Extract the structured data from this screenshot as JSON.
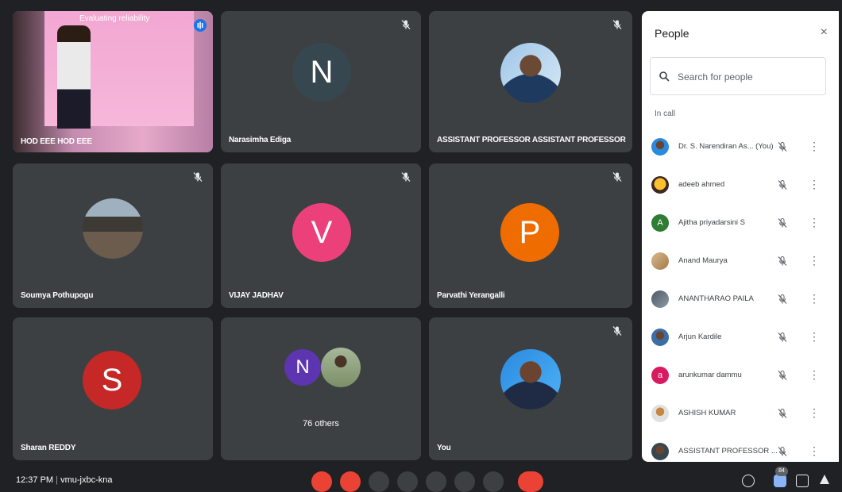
{
  "tiles": [
    {
      "name": "HOD EEE HOD EEE",
      "slide_title": "Evaluating reliability"
    },
    {
      "name": "Narasimha Ediga",
      "initial": "N"
    },
    {
      "name": "ASSISTANT PROFESSOR ASSISTANT PROFESSOR"
    },
    {
      "name": "Soumya Pothupogu"
    },
    {
      "name": "VIJAY JADHAV",
      "initial": "V"
    },
    {
      "name": "Parvathi Yerangalli",
      "initial": "P"
    },
    {
      "name": "Sharan REDDY",
      "initial": "S"
    },
    {
      "name": "76 others",
      "initial": "N"
    },
    {
      "name": "You"
    }
  ],
  "people": {
    "title": "People",
    "close": "×",
    "search_placeholder": "Search for people",
    "section": "In call",
    "list": [
      {
        "name": "Dr. S. Narendiran As...  (You)"
      },
      {
        "name": "adeeb ahmed"
      },
      {
        "name": "Ajitha priyadarsini S",
        "initial": "A"
      },
      {
        "name": "Anand Maurya"
      },
      {
        "name": "ANANTHARAO PAILA"
      },
      {
        "name": "Arjun Kardile"
      },
      {
        "name": "arunkumar dammu",
        "initial": "a"
      },
      {
        "name": "ASHISH KUMAR"
      },
      {
        "name": "ASSISTANT PROFESSOR ..."
      }
    ]
  },
  "bottom_bar": {
    "time": "12:37 PM",
    "meeting": "vmu-jxbc-kna",
    "people_count": "84"
  },
  "colors": {
    "background": "#202124",
    "tile": "#3c4043",
    "accent": "#8ab4f8",
    "red": "#ea4335",
    "avatar_n": "#37474f",
    "avatar_v": "#ec407a",
    "avatar_p": "#ef6c00",
    "avatar_s": "#c62828",
    "avatar_a": "#2e7d32",
    "avatar_arun": "#d81b60"
  },
  "icons": [
    "mic-off-icon",
    "audio-active-icon",
    "search-icon",
    "close-icon",
    "more-vert-icon",
    "present-icon",
    "chat-icon",
    "end-call-icon",
    "info-icon",
    "people-icon",
    "activities-icon"
  ]
}
